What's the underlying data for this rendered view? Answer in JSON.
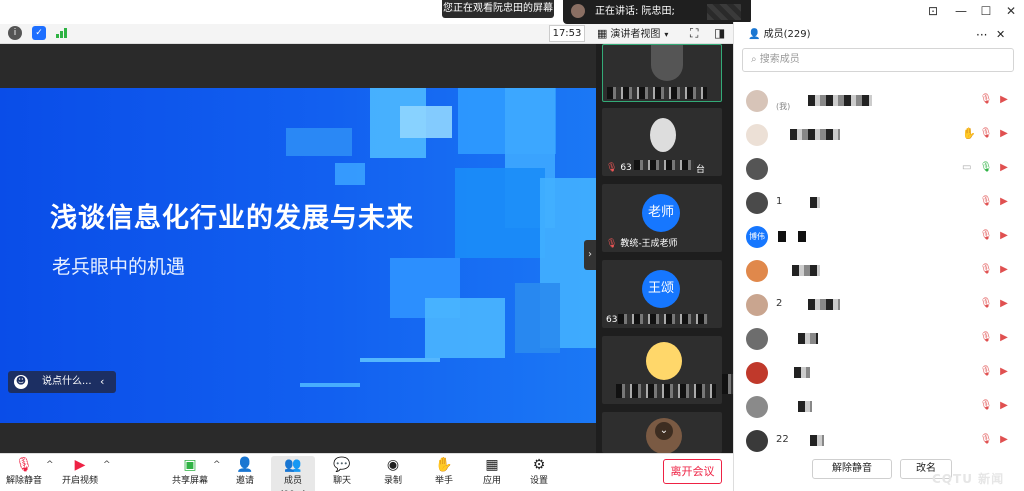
{
  "banners": {
    "viewing": "您正在观看阮忠田的屏幕",
    "speaking": "正在讲话: 阮忠田;"
  },
  "topbar": {
    "time": "17:53",
    "view_mode": "演讲者视图"
  },
  "slide": {
    "title": "浅谈信息化行业的发展与未来",
    "subtitle": "老兵眼中的机遇",
    "chat_placeholder": "说点什么..."
  },
  "gallery": [
    {
      "label": "",
      "avatar_text": ""
    },
    {
      "label": "63",
      "label_suffix": "台",
      "avatar_text": ""
    },
    {
      "label": "教统-王成老师",
      "avatar_text": "老师"
    },
    {
      "label": "63",
      "avatar_text": "王颂"
    },
    {
      "label": "",
      "avatar_text": ""
    },
    {
      "label": "",
      "avatar_text": ""
    }
  ],
  "members": {
    "header": "成员(229)",
    "search_placeholder": "搜索成员",
    "rows": [
      {
        "name": "",
        "note": "(我)"
      },
      {
        "name": ""
      },
      {
        "name": ""
      },
      {
        "name": "1"
      },
      {
        "name": "",
        "avatar_text": "博伟"
      },
      {
        "name": ""
      },
      {
        "name": "2"
      },
      {
        "name": ""
      },
      {
        "name": ""
      },
      {
        "name": ""
      },
      {
        "name": "22"
      }
    ],
    "mute_all": "解除静音",
    "rename": "改名"
  },
  "toolbar": {
    "unmute": "解除静音",
    "start_video": "开启视频",
    "share": "共享屏幕",
    "invite": "邀请",
    "members": "成员(99+)",
    "chat": "聊天",
    "record": "录制",
    "raise_hand": "举手",
    "apps": "应用",
    "settings": "设置",
    "leave": "离开会议"
  },
  "watermark": "CQTU 新闻",
  "colors": {
    "accent": "#1677ff",
    "danger": "#e24444",
    "slide_blue": "#1260f0"
  }
}
